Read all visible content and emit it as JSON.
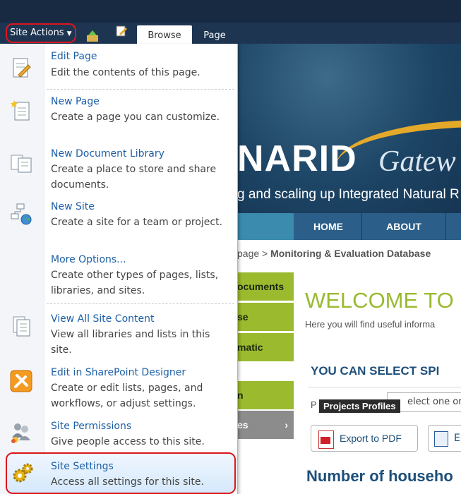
{
  "ribbon": {
    "site_actions_label": "Site Actions",
    "tabs": [
      {
        "label": "Browse"
      },
      {
        "label": "Page"
      }
    ]
  },
  "menu": {
    "items": [
      {
        "title": "Edit Page",
        "description": "Edit the contents of this page.",
        "icon": "edit-page-icon"
      },
      {
        "title": "New Page",
        "description": "Create a page you can customize.",
        "icon": "new-page-icon"
      },
      {
        "title": "New Document Library",
        "description": "Create a place to store and share documents.",
        "icon": "document-library-icon"
      },
      {
        "title": "New Site",
        "description": "Create a site for a team or project.",
        "icon": "new-site-icon"
      },
      {
        "title": "More Options...",
        "description": "Create other types of pages, lists, libraries, and sites.",
        "icon": "none"
      },
      {
        "title": "View All Site Content",
        "description": "View all libraries and lists in this site.",
        "icon": "site-content-icon"
      },
      {
        "title": "Edit in SharePoint Designer",
        "description": "Create or edit lists, pages, and workflows, or adjust settings.",
        "icon": "sharepoint-designer-icon"
      },
      {
        "title": "Site Permissions",
        "description": "Give people access to this site.",
        "icon": "permissions-icon"
      },
      {
        "title": "Site Settings",
        "description": "Access all settings for this site.",
        "icon": "settings-gear-icon"
      }
    ]
  },
  "page": {
    "logo_main": "NARID",
    "logo_secondary": "Gatew",
    "tagline": "g and scaling up Integrated Natural R",
    "nav": [
      {
        "label": "HOME"
      },
      {
        "label": "ABOUT"
      }
    ],
    "breadcrumb_prefix": "page >",
    "breadcrumb_current": "Monitoring & Evaluation Database",
    "sidebar": [
      {
        "label": "ocuments"
      },
      {
        "label": "se"
      },
      {
        "label": "matic"
      },
      {
        "label": "n"
      },
      {
        "label": "es"
      }
    ],
    "welcome": "WELCOME TO",
    "welcome_sub": "Here you will find useful informa",
    "select_heading": "YOU CAN SELECT SPI",
    "select_label": "P",
    "select_value": "elect one or",
    "tooltip": "Projects Profiles",
    "export_pdf": "Export to PDF",
    "export_word": "E",
    "households_heading": "Number of househo"
  },
  "colors": {
    "ribbon": "#1e3552",
    "accent_green": "#9cba2e",
    "link_blue": "#1d5fa6",
    "highlight_red": "#d9161c"
  }
}
